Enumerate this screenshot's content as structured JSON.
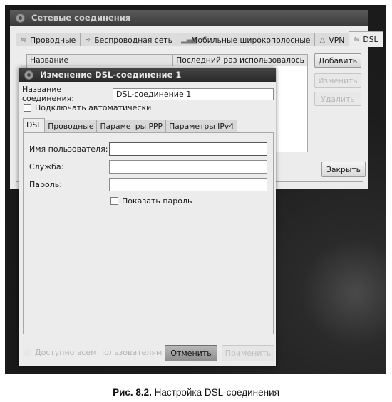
{
  "background_window": {
    "title": "Сетевые соединения",
    "tabs": [
      {
        "label": "Проводные",
        "icon": "wired-icon"
      },
      {
        "label": "Беспроводная сеть",
        "icon": "wireless-icon"
      },
      {
        "label": "Мобильные широкополосные",
        "icon": "mobile-signal-icon"
      },
      {
        "label": "VPN",
        "icon": "vpn-icon"
      },
      {
        "label": "DSL",
        "icon": "dsl-icon",
        "active": true
      }
    ],
    "list_columns": [
      "Название",
      "Последний раз использовалось"
    ],
    "buttons": {
      "add": "Добавить",
      "edit": "Изменить",
      "delete": "Удалить",
      "close": "Закрыть"
    }
  },
  "dialog": {
    "title": "Изменение DSL-соединение 1",
    "connection_name_label": "Название соединения:",
    "connection_name_value": "DSL-соединение 1",
    "auto_connect_label": "Подключать автоматически",
    "tabs": [
      "DSL",
      "Проводные",
      "Параметры PPP",
      "Параметры IPv4"
    ],
    "fields": {
      "username_label": "Имя пользователя:",
      "username_value": "",
      "service_label": "Служба:",
      "service_value": "",
      "password_label": "Пароль:",
      "password_value": ""
    },
    "show_password_label": "Показать пароль",
    "available_all_users_label": "Доступно всем пользователям",
    "buttons": {
      "cancel": "Отменить",
      "apply": "Применить"
    }
  },
  "caption": {
    "prefix": "Рис. 8.2.",
    "text": " Настройка DSL-соединения"
  }
}
